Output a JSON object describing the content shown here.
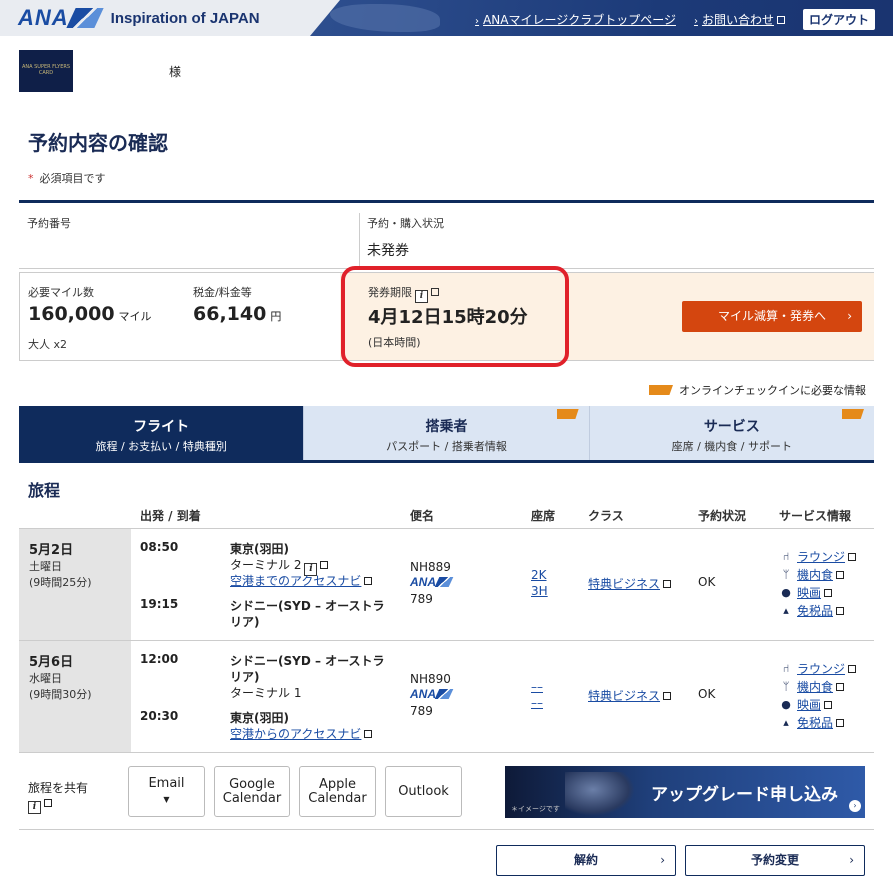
{
  "header": {
    "brand": "ANA",
    "tagline": "Inspiration of JAPAN",
    "links": [
      {
        "label": "ANAマイレージクラブトップページ"
      },
      {
        "label": "お問い合わせ"
      }
    ],
    "logout": "ログアウト"
  },
  "user": {
    "card_text": "ANA SUPER FLYERS CARD",
    "honorific": "様"
  },
  "page": {
    "title": "予約内容の確認",
    "required_note": "必須項目です",
    "required_mark": "*"
  },
  "booking": {
    "ref_label": "予約番号",
    "status_label": "予約・購入状況",
    "status_value": "未発券",
    "miles_label": "必要マイル数",
    "miles_value": "160,000",
    "miles_unit": "マイル",
    "pax": "大人 x2",
    "tax_label": "税金/料金等",
    "tax_value": "66,140",
    "tax_unit": "円",
    "deadline_label": "発券期限",
    "deadline_value": "4月12日15時20分",
    "deadline_tz": "(日本時間)",
    "issue_button": "マイル減算・発券へ",
    "checkin_info": "オンラインチェックインに必要な情報"
  },
  "tabs": [
    {
      "title": "フライト",
      "sub": "旅程 / お支払い / 特典種別"
    },
    {
      "title": "搭乗者",
      "sub": "パスポート / 搭乗者情報"
    },
    {
      "title": "サービス",
      "sub": "座席 / 機内食 / サポート"
    }
  ],
  "itinerary": {
    "title": "旅程",
    "columns": {
      "depart_arrive": "出発 / 到着",
      "flight": "便名",
      "seat": "座席",
      "class": "クラス",
      "status": "予約状況",
      "service": "サービス情報"
    },
    "segments": [
      {
        "date": "5月2日",
        "weekday": "土曜日",
        "duration": "(9時間25分)",
        "dep_time": "08:50",
        "dep_place": "東京(羽田)",
        "dep_terminal": "ターミナル 2",
        "dep_access": "空港までのアクセスナビ",
        "arr_time": "19:15",
        "arr_place_1": "シドニー(SYD – オーストラ",
        "arr_place_2": "リア)",
        "flight_no": "NH889",
        "airline": "ANA",
        "aircraft": "789",
        "seat_1": "2K",
        "seat_2": "3H",
        "class": "特典ビジネス",
        "status": "OK",
        "services": [
          "ラウンジ",
          "機内食",
          "映画",
          "免税品"
        ]
      },
      {
        "date": "5月6日",
        "weekday": "水曜日",
        "duration": "(9時間30分)",
        "dep_time": "12:00",
        "dep_place_1": "シドニー(SYD – オーストラ",
        "dep_place_2": "リア)",
        "dep_terminal": "ターミナル 1",
        "arr_time": "20:30",
        "arr_place": "東京(羽田)",
        "arr_access": "空港からのアクセスナビ",
        "flight_no": "NH890",
        "airline": "ANA",
        "aircraft": "789",
        "seat_1": "––",
        "seat_2": "––",
        "class": "特典ビジネス",
        "status": "OK",
        "services": [
          "ラウンジ",
          "機内食",
          "映画",
          "免税品"
        ]
      }
    ]
  },
  "share": {
    "label": "旅程を共有",
    "email": "Email",
    "google_1": "Google",
    "google_2": "Calendar",
    "apple_1": "Apple",
    "apple_2": "Calendar",
    "outlook": "Outlook"
  },
  "banner": {
    "text": "アップグレード申し込み",
    "note": "＊イメージです"
  },
  "footer": {
    "cancel": "解約",
    "change": "予約変更"
  },
  "colors": {
    "navy": "#0f2b5c",
    "accent": "#d4460f",
    "highlight_ring": "#e0212a",
    "peach": "#fdf1e3",
    "link": "#1a4ca3"
  }
}
